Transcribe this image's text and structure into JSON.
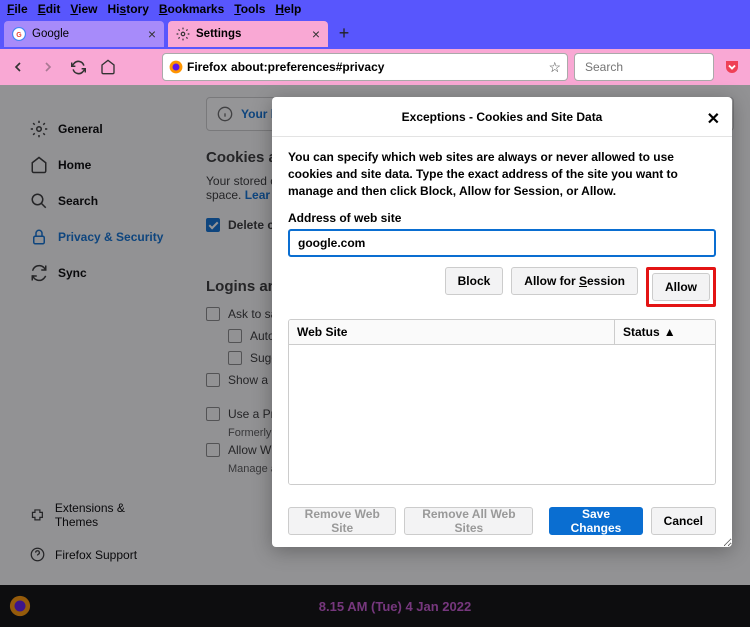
{
  "menubar": [
    "File",
    "Edit",
    "View",
    "History",
    "Bookmarks",
    "Tools",
    "Help"
  ],
  "tabs": [
    {
      "title": "Google",
      "icon": "google"
    },
    {
      "title": "Settings",
      "icon": "gear"
    }
  ],
  "url": {
    "branding": "Firefox",
    "address": "about:preferences#privacy",
    "search_placeholder": "Search"
  },
  "sidebar": {
    "items": [
      {
        "label": "General"
      },
      {
        "label": "Home"
      },
      {
        "label": "Search"
      },
      {
        "label": "Privacy & Security"
      },
      {
        "label": "Sync"
      }
    ],
    "footer": [
      {
        "label": "Extensions & Themes"
      },
      {
        "label": "Firefox Support"
      }
    ]
  },
  "page": {
    "banner_prefix": "Your brow",
    "cookies_heading": "Cookies and",
    "cookies_desc": "Your stored c",
    "cookies_desc2": "space.   ",
    "learn": "Lear",
    "chk_delete": "Delete coo",
    "logins_heading": "Logins and",
    "chk_ask": "Ask to sav",
    "chk_autofi": "Autofi",
    "chk_sugge": "Sugge",
    "chk_show": "Show a",
    "chk_use": "Use a Pri",
    "formerly": "Formerly l",
    "chk_allow_win": "Allow Wi",
    "manage": "Manage ac"
  },
  "dialog": {
    "title": "Exceptions - Cookies and Site Data",
    "desc": "You can specify which web sites are always or never allowed to use cookies and site data. Type the exact address of the site you want to manage and then click Block, Allow for Session, or Allow.",
    "addr_label": "Address of web site",
    "addr_value": "google.com",
    "btn_block": "Block",
    "btn_session": "Allow for Session",
    "btn_allow": "Allow",
    "col_website": "Web Site",
    "col_status": "Status",
    "btn_remove": "Remove Web Site",
    "btn_remove_all": "Remove All Web Sites",
    "btn_save": "Save Changes",
    "btn_cancel": "Cancel"
  },
  "clock": "8.15 AM (Tue) 4 Jan 2022"
}
